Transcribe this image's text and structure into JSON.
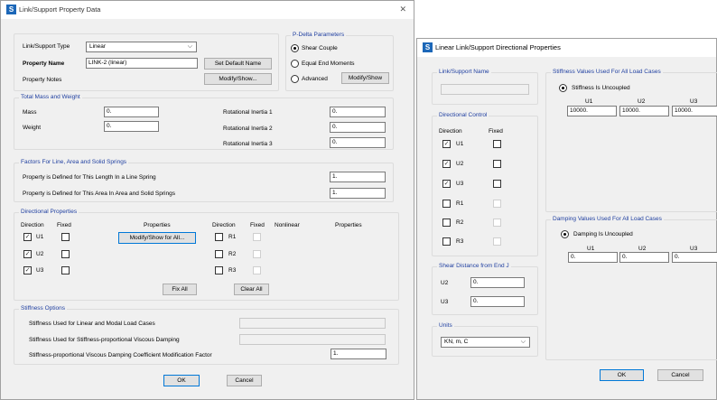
{
  "left": {
    "title": "Link/Support Property Data",
    "type_label": "Link/Support Type",
    "type_value": "Linear",
    "name_label": "Property Name",
    "name_value": "LINK-2 (linear)",
    "notes_label": "Property Notes",
    "set_default_label": "Set Default Name",
    "modify_show_label": "Modify/Show...",
    "pdelta": {
      "title": "P-Delta Parameters",
      "options": [
        "Shear Couple",
        "Equal End Moments",
        "Advanced"
      ],
      "selected": "Shear Couple",
      "modify_label": "Modify/Show"
    },
    "mass": {
      "title": "Total Mass and Weight",
      "mass_label": "Mass",
      "mass_value": "0.",
      "weight_label": "Weight",
      "weight_value": "0.",
      "rot1_label": "Rotational Inertia 1",
      "rot1_value": "0.",
      "rot2_label": "Rotational Inertia 2",
      "rot2_value": "0.",
      "rot3_label": "Rotational Inertia 3",
      "rot3_value": "0."
    },
    "factors": {
      "title": "Factors For Line, Area and Solid Springs",
      "line_label": "Property is Defined for This Length In a Line Spring",
      "line_value": "1.",
      "area_label": "Property is Defined for This Area In Area and Solid Springs",
      "area_value": "1."
    },
    "dirprops": {
      "title": "Directional Properties",
      "h_direction": "Direction",
      "h_fixed": "Fixed",
      "h_properties": "Properties",
      "h_nonlinear": "Nonlinear",
      "modify_all_label": "Modify/Show for All...",
      "u1": "U1",
      "u2": "U2",
      "u3": "U3",
      "r1": "R1",
      "r2": "R2",
      "r3": "R3",
      "fix_all_label": "Fix All",
      "clear_all_label": "Clear All"
    },
    "stiff": {
      "title": "Stiffness Options",
      "row1_label": "Stiffness Used for Linear and Modal Load Cases",
      "row2_label": "Stiffness Used for Stiffness-proportional Viscous Damping",
      "row3_label": "Stiffness-proportional Viscous Damping Coefficient Modification Factor",
      "row3_value": "1."
    },
    "ok_label": "OK",
    "cancel_label": "Cancel"
  },
  "right": {
    "title": "Linear Link/Support Directional Properties",
    "name_group": "Link/Support Name",
    "dir_group": "Directional Control",
    "h_direction": "Direction",
    "h_fixed": "Fixed",
    "u1": "U1",
    "u2": "U2",
    "u3": "U3",
    "r1": "R1",
    "r2": "R2",
    "r3": "R3",
    "shear_group": "Shear Distance from End J",
    "u2_value": "0.",
    "u3_value": "0.",
    "units_group": "Units",
    "units_value": "KN, m, C",
    "stiffness": {
      "title": "Stiffness Values Used For All Load Cases",
      "radio_label": "Stiffness Is Uncoupled",
      "u1_label": "U1",
      "u2_label": "U2",
      "u3_label": "U3",
      "u1_value": "10000.",
      "u2_value": "10000.",
      "u3_value": "10000."
    },
    "damping": {
      "title": "Damping Values Used For All Load Cases",
      "radio_label": "Damping Is Uncoupled",
      "u1_label": "U1",
      "u2_label": "U2",
      "u3_label": "U3",
      "u1_value": "0.",
      "u2_value": "0.",
      "u3_value": "0."
    },
    "ok_label": "OK",
    "cancel_label": "Cancel"
  },
  "icons": {
    "app": "S",
    "close": "✕",
    "check": "✓",
    "dropdown": "⌵"
  },
  "colors": {
    "group_title": "#1f3fa0",
    "app_icon": "#1c67b8",
    "default_button_border": "#0078d7"
  }
}
